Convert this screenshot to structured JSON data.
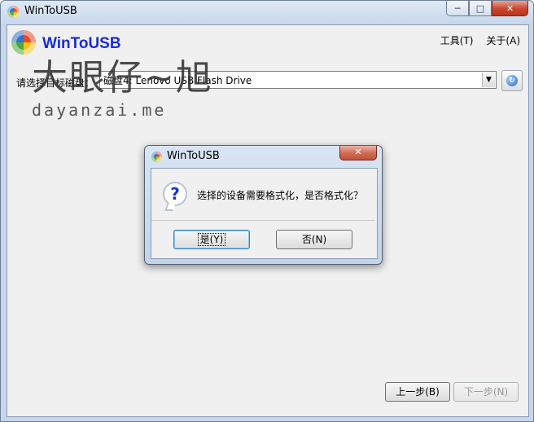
{
  "window": {
    "title": "WinToUSB"
  },
  "header": {
    "logo_text": "WinToUSB"
  },
  "menu": {
    "tools": "工具(T)",
    "about": "关于(A)"
  },
  "watermark": {
    "cn": "大眼仔~旭",
    "en": "dayanzai.me"
  },
  "disk": {
    "label": "请选择目标磁盘：",
    "selected": "磁盘4: Lenovo  USB Flash Drive"
  },
  "dialog": {
    "title": "WinToUSB",
    "message": "选择的设备需要格式化，是否格式化？",
    "yes_label": "是(Y)",
    "no_label": "否(N)"
  },
  "nav": {
    "prev_label": "上一步(B)",
    "next_label": "下一步(N)"
  }
}
